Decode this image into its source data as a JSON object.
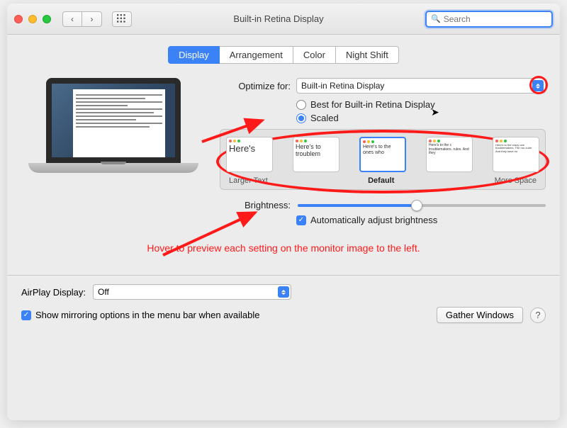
{
  "window": {
    "title": "Built-in Retina Display"
  },
  "search": {
    "placeholder": "Search"
  },
  "tabs": [
    "Display",
    "Arrangement",
    "Color",
    "Night Shift"
  ],
  "active_tab": 0,
  "optimize": {
    "label": "Optimize for:",
    "value": "Built-in Retina Display"
  },
  "resolution": {
    "best_label": "Best for Built-in Retina Display",
    "scaled_label": "Scaled",
    "selected": "scaled"
  },
  "scale_options": {
    "thumbs": [
      {
        "text": "Here's"
      },
      {
        "text": "Here's to troublem"
      },
      {
        "text": "Here's to the ones who"
      },
      {
        "text": "Here's to the c troublemakers. rules. And they"
      },
      {
        "text": "Here's to the crazy one troublemakers. The rou cube. And they have no"
      }
    ],
    "larger_label": "Larger Text",
    "default_label": "Default",
    "more_label": "More Space",
    "selected_index": 2
  },
  "brightness": {
    "label": "Brightness:",
    "value_pct": 48,
    "auto_label": "Automatically adjust brightness",
    "auto_checked": true
  },
  "annotation": "Hover to preview each setting on the monitor image to the left.",
  "airplay": {
    "label": "AirPlay Display:",
    "value": "Off"
  },
  "mirroring": {
    "label": "Show mirroring options in the menu bar when available",
    "checked": true
  },
  "gather_btn": "Gather Windows",
  "help": "?"
}
